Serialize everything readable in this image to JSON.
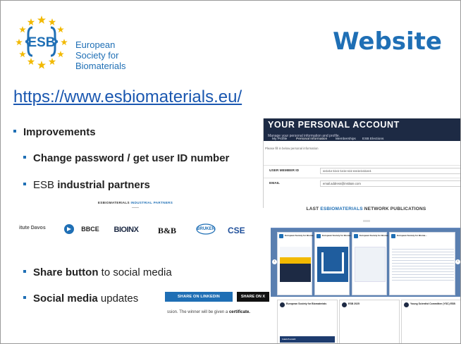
{
  "logo": {
    "line1": "European",
    "line2": "Society for",
    "line3": "Biomaterials",
    "esb": "ESB"
  },
  "title": "Website",
  "url": "https://www.esbiomaterials.eu/",
  "bullets": {
    "improvements": "Improvements",
    "change_password": "Change password / get user ID number",
    "partners_pre": "ESB ",
    "partners_bold": "industrial partners",
    "share_bold": "Share button",
    "share_rest": " to social media",
    "social_bold": "Social media",
    "social_rest": " updates"
  },
  "partners_panel": {
    "heading_pre": "ESBIOMATERIALS ",
    "heading_accent": "INDUSTRIAL PARTNERS",
    "logos": [
      "itute Davos",
      "BBCE",
      "BIOINX",
      "B&B",
      "BRUKER",
      "CSE"
    ]
  },
  "social_buttons": {
    "linkedin": "SHARE ON LINKEDIN",
    "x": "SHARE ON X",
    "note_pre": "ssion. The winner will be given a ",
    "note_bold": "certificate."
  },
  "account": {
    "title": "YOUR PERSONAL ACCOUNT",
    "subtitle": "Manage your personal information and profile.",
    "tabs": [
      "My Profile",
      "Personal Information",
      "Memberships",
      "ESB Elections"
    ],
    "hint": "Please fill in below personal information",
    "fields": [
      {
        "label": "USER MEMBER ID",
        "value": "xx1x1x-11x1-1x1x-x11-xxx1x1x11xx1"
      },
      {
        "label": "EMAIL",
        "value": "email.address@institute.com"
      }
    ]
  },
  "publications": {
    "heading_pre": "LAST ",
    "heading_accent": "ESBIOMATERIALS",
    "heading_post": " NETWORK PUBLICATIONS",
    "card_author": "European Society for Bioma...",
    "tile_authors": [
      "European Society for Biomaterials",
      "ESB 2025",
      "Young Scientist Committee (YSC) ESB"
    ],
    "tile_footer": "Launch event"
  },
  "colors": {
    "brand_blue": "#1f6fb5",
    "navy": "#1d2a44",
    "star_yellow": "#f2b900"
  }
}
